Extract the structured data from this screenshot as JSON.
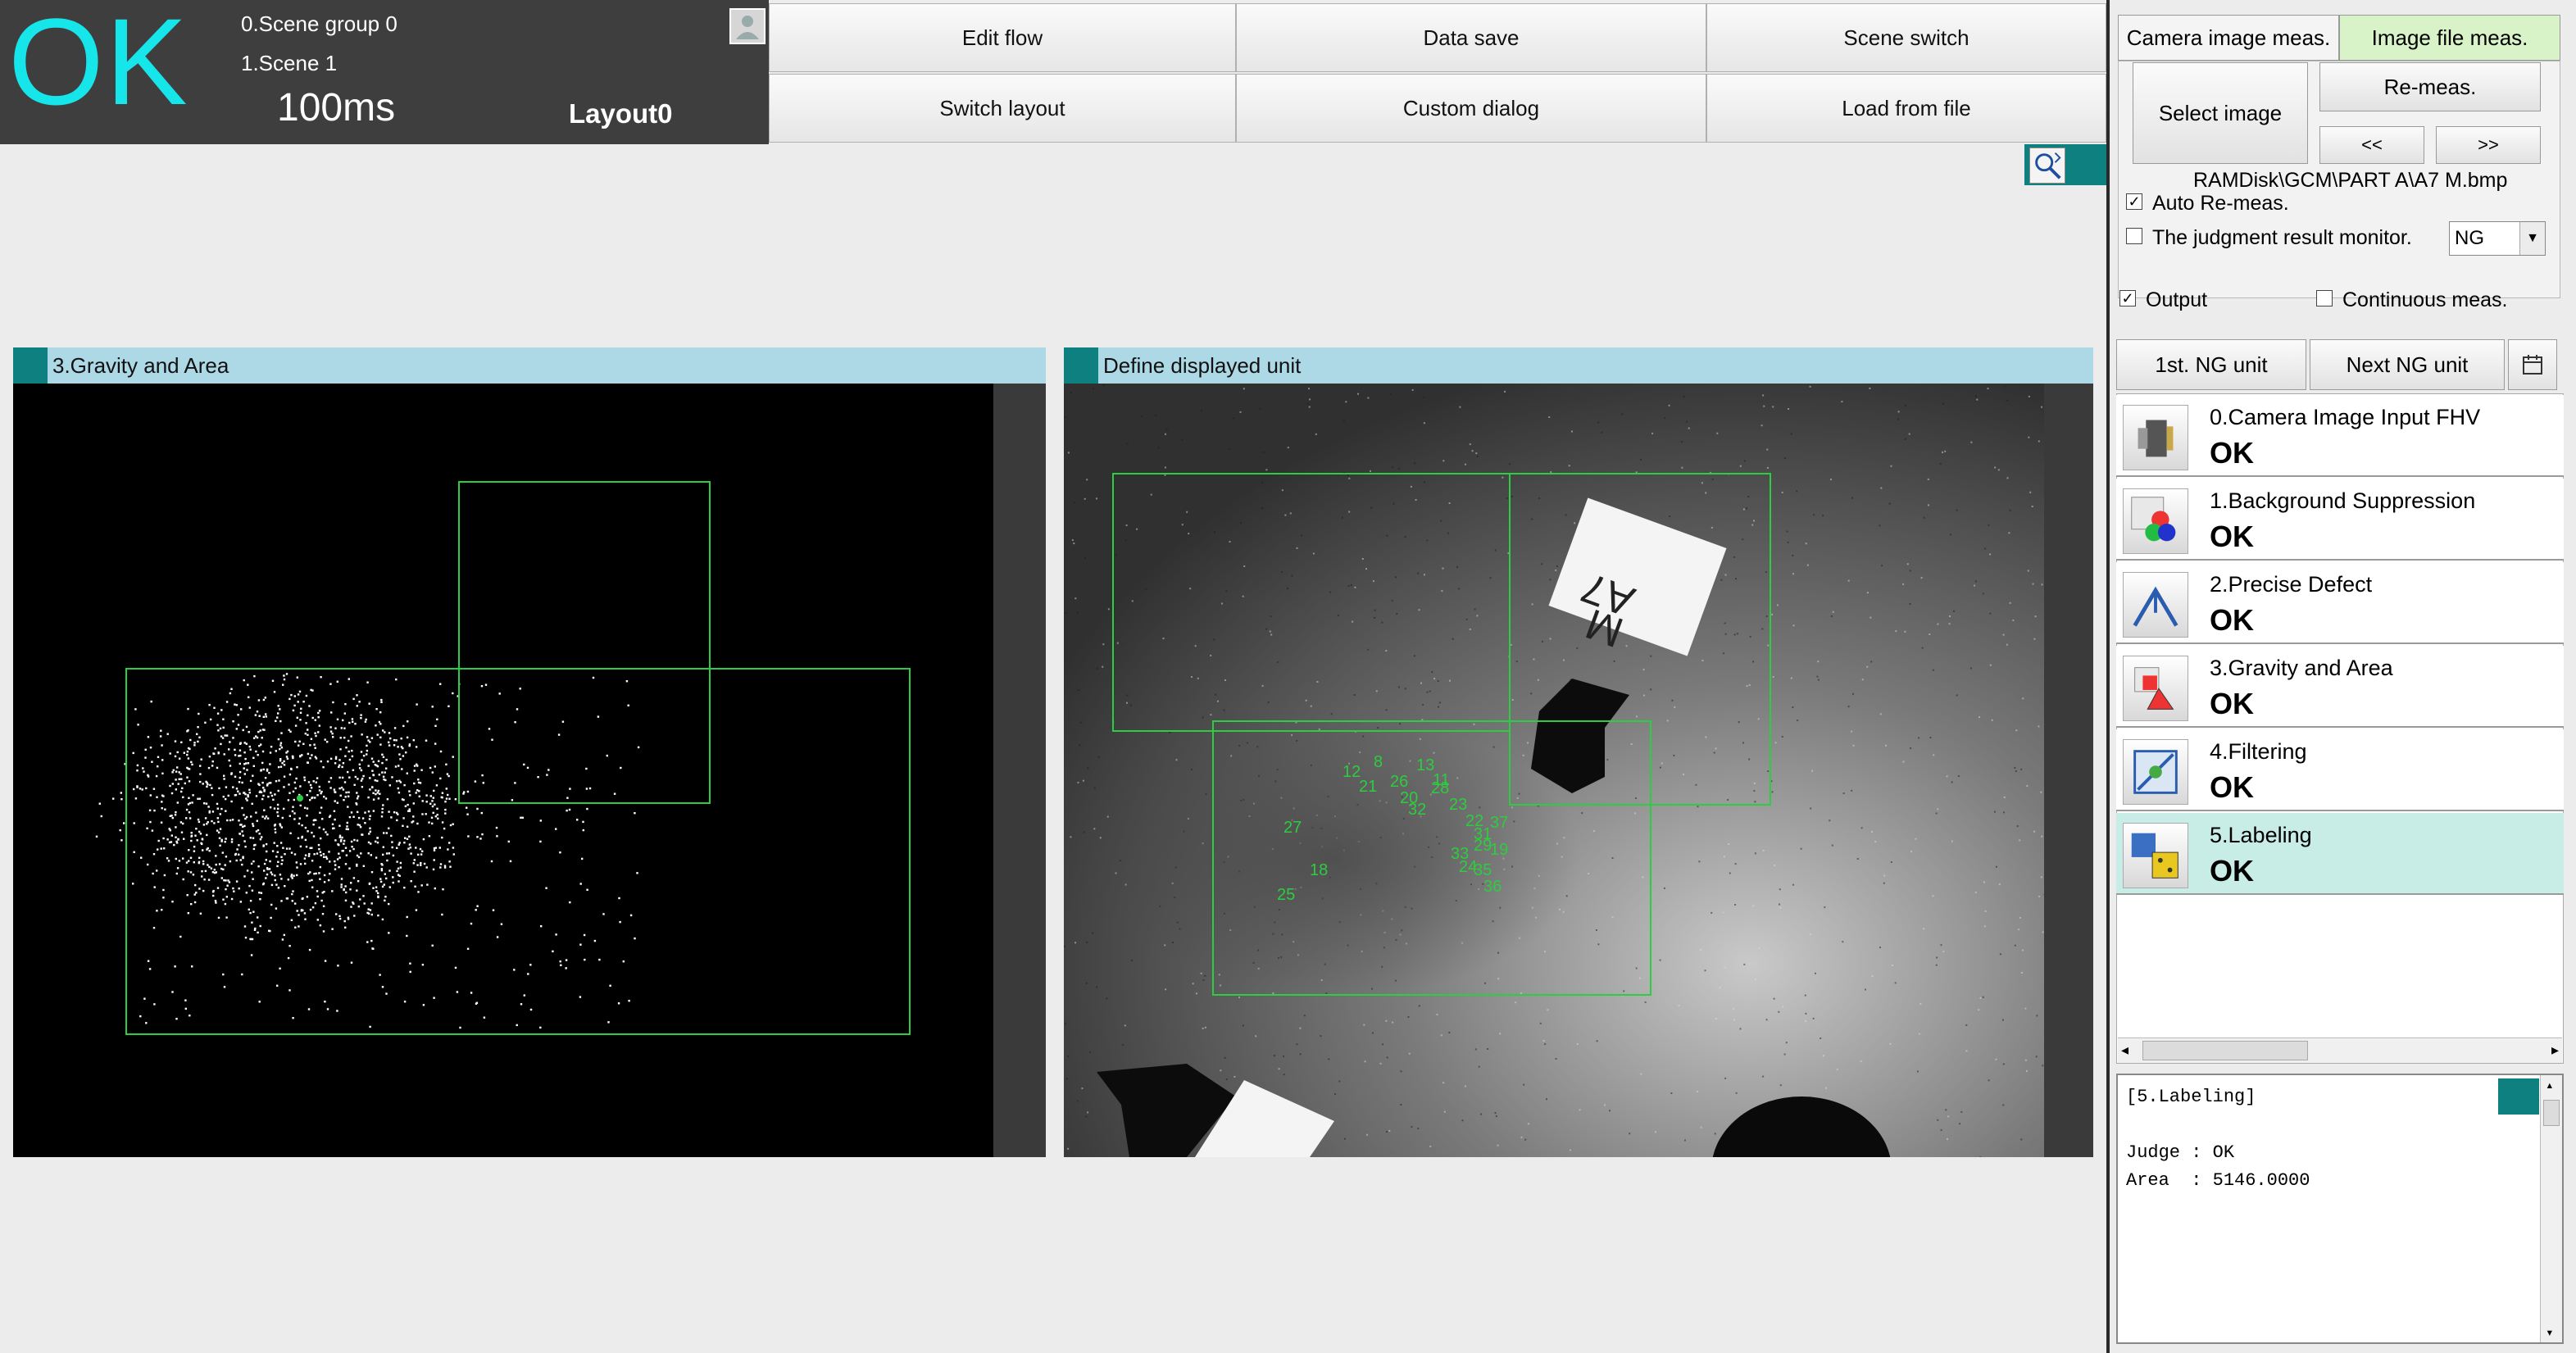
{
  "header": {
    "judge": "OK",
    "scene_group": "0.Scene group 0",
    "scene": "1.Scene 1",
    "time": "100ms",
    "layout": "Layout0"
  },
  "toolbar": {
    "edit_flow": "Edit flow",
    "data_save": "Data save",
    "scene_switch": "Scene switch",
    "switch_layout": "Switch layout",
    "custom_dialog": "Custom dialog",
    "load_from_file": "Load from file"
  },
  "panels": {
    "left_title": "3.Gravity and Area",
    "right_title": "Define displayed unit"
  },
  "right": {
    "tab_camera": "Camera image meas.",
    "tab_file": "Image file meas.",
    "select_image": "Select image",
    "re_meas": "Re-meas.",
    "prev": "<<",
    "next": ">>",
    "path": "RAMDisk\\GCM\\PART A\\A7  M.bmp",
    "auto_remeas": "Auto Re-meas.",
    "judgment_monitor": "The judgment result monitor.",
    "judgment_value": "NG",
    "output": "Output",
    "continuous": "Continuous meas.",
    "first_ng": "1st. NG unit",
    "next_ng": "Next NG unit"
  },
  "units": [
    {
      "name": "0.Camera Image Input FHV",
      "result": "OK"
    },
    {
      "name": "1.Background Suppression",
      "result": "OK"
    },
    {
      "name": "2.Precise Defect",
      "result": "OK"
    },
    {
      "name": "3.Gravity and Area",
      "result": "OK"
    },
    {
      "name": "4.Filtering",
      "result": "OK"
    },
    {
      "name": "5.Labeling",
      "result": "OK"
    }
  ],
  "detail": {
    "header": "[5.Labeling]",
    "judge": "Judge : OK",
    "area": "Area  : 5146.0000"
  },
  "overlay_labels": [
    "12",
    "8",
    "13",
    "21",
    "26",
    "28",
    "20",
    "23",
    "22",
    "31",
    "37",
    "33",
    "35",
    "36",
    "24",
    "29",
    "32",
    "27",
    "18",
    "25",
    "11",
    "19"
  ],
  "colors": {
    "judge_ok": "#16e5ea",
    "accent_teal": "#0e8080",
    "panel_title_bg": "#add8e6",
    "roi_green": "#2ecc40",
    "selected_unit": "#c8ece6"
  }
}
